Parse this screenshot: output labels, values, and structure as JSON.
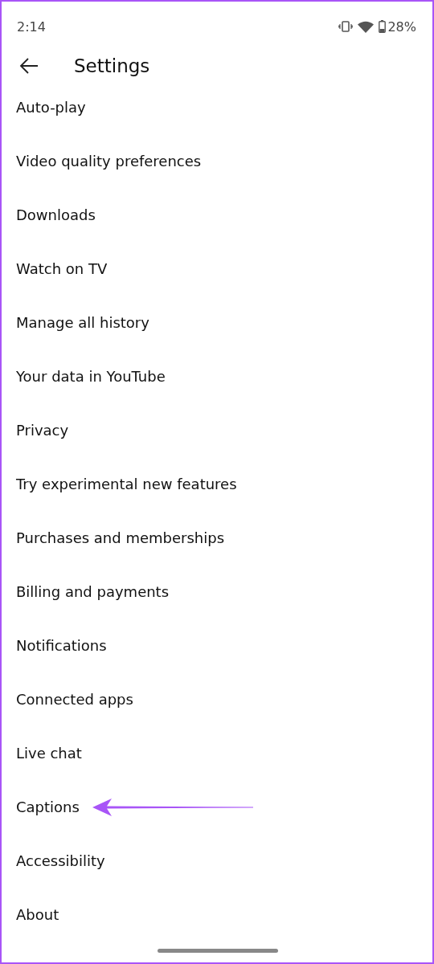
{
  "status_bar": {
    "time": "2:14",
    "battery": "28%"
  },
  "header": {
    "title": "Settings"
  },
  "items": [
    {
      "label": "Auto-play",
      "pointed": false
    },
    {
      "label": "Video quality preferences",
      "pointed": false
    },
    {
      "label": "Downloads",
      "pointed": false
    },
    {
      "label": "Watch on TV",
      "pointed": false
    },
    {
      "label": "Manage all history",
      "pointed": false
    },
    {
      "label": "Your data in YouTube",
      "pointed": false
    },
    {
      "label": "Privacy",
      "pointed": false
    },
    {
      "label": "Try experimental new features",
      "pointed": false
    },
    {
      "label": "Purchases and memberships",
      "pointed": false
    },
    {
      "label": "Billing and payments",
      "pointed": false
    },
    {
      "label": "Notifications",
      "pointed": false
    },
    {
      "label": "Connected apps",
      "pointed": false
    },
    {
      "label": "Live chat",
      "pointed": false
    },
    {
      "label": "Captions",
      "pointed": true
    },
    {
      "label": "Accessibility",
      "pointed": false
    },
    {
      "label": "About",
      "pointed": false
    }
  ]
}
